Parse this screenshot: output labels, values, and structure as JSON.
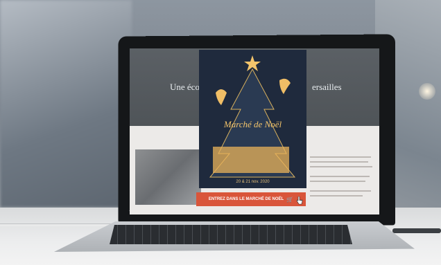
{
  "website": {
    "hero_left_text": "Une écol",
    "hero_right_text": "ersailles"
  },
  "poster": {
    "title": "Marché de Noël",
    "dates": "20 & 21 nov. 2020"
  },
  "cta": {
    "label": "ENTREZ DANS LE MARCHÉ DE NOËL",
    "icon": "cart-icon"
  },
  "colors": {
    "accent": "#d9553a",
    "poster_bg": "#1f2a3d",
    "gold": "#f3c46b"
  }
}
